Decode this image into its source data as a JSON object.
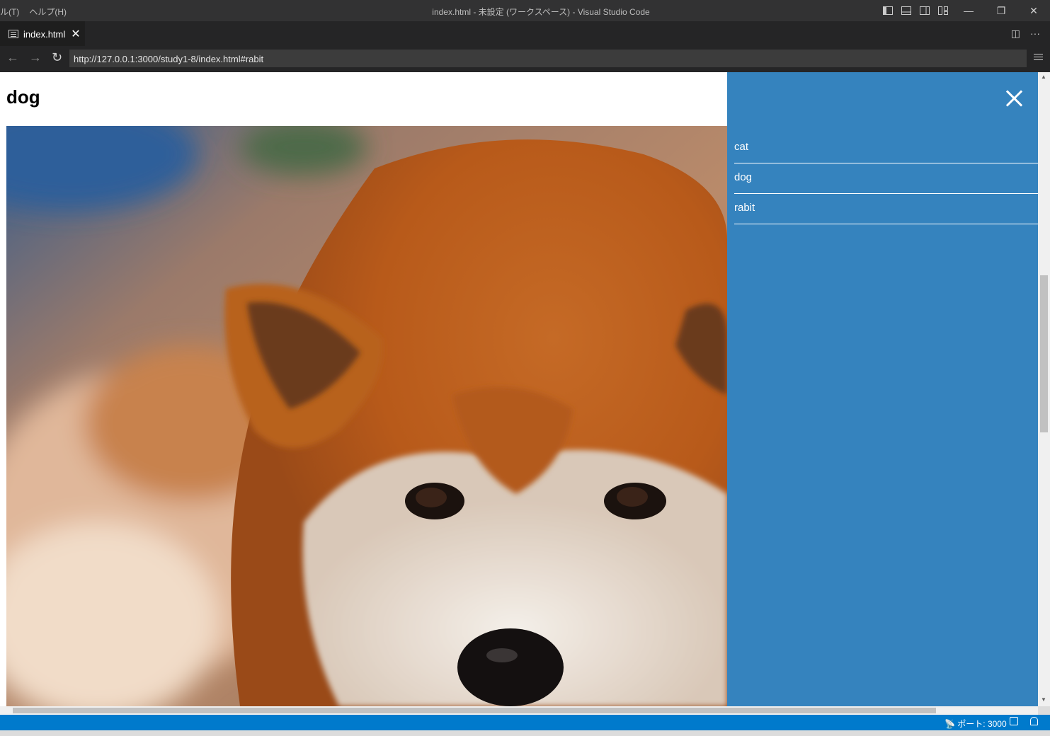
{
  "titlebar": {
    "menu": [
      "ル(T)",
      "ヘルプ(H)"
    ],
    "title": "index.html - 未設定 (ワークスペース) - Visual Studio Code",
    "window_controls": {
      "minimize": "—",
      "restore": "❐",
      "close": "✕"
    }
  },
  "tab": {
    "label": "index.html",
    "close": "✕"
  },
  "tab_actions": {
    "split": "◫",
    "more": "···"
  },
  "browser": {
    "url": "http://127.0.0.1:3000/study1-8/index.html#rabit",
    "back": "←",
    "forward": "→",
    "reload": "↻"
  },
  "page": {
    "heading": "dog"
  },
  "drawer": {
    "close_icon": "close-icon",
    "items": [
      {
        "label": "cat"
      },
      {
        "label": "dog"
      },
      {
        "label": "rabit"
      }
    ],
    "color": "#3583be"
  },
  "statusbar": {
    "port": "📡 ポート: 3000",
    "color": "#007acc"
  }
}
